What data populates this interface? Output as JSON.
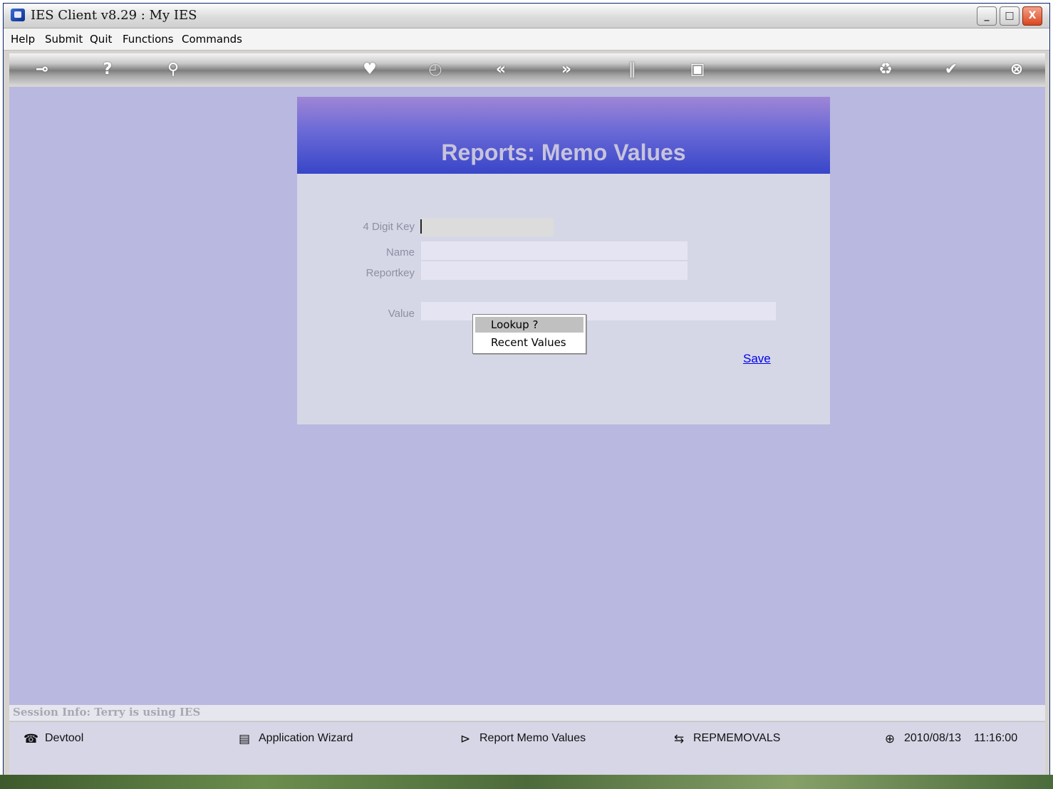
{
  "window": {
    "title": "IES Client v8.29 : My IES",
    "controls": {
      "minimize": "_",
      "maximize": "□",
      "close": "X"
    }
  },
  "menu": [
    "Help",
    "Submit",
    "Quit",
    "Functions",
    "Commands"
  ],
  "toolbar": {
    "icons": [
      "key-icon",
      "help-icon",
      "search-icon",
      "heart-icon",
      "clock-icon",
      "back-icon",
      "forward-icon",
      "tools-icon",
      "chip-icon",
      "recycle-icon",
      "check-icon",
      "close-icon"
    ],
    "glyphs": {
      "key": "⊸",
      "help": "?",
      "search": "⚲",
      "heart": "♥",
      "clock": "◴",
      "back": "«",
      "forward": "»",
      "tools": "‖",
      "chip": "▣",
      "recycle": "♻",
      "check": "✔",
      "close": "⊗"
    }
  },
  "form": {
    "title": "Reports: Memo Values",
    "fields": {
      "key_label": "4 Digit Key",
      "name_label": "Name",
      "reportkey_label": "Reportkey",
      "value_label": "Value"
    },
    "save_label": "Save"
  },
  "context_menu": {
    "items": [
      "Lookup ?",
      "Recent Values"
    ],
    "selected_index": 0
  },
  "session": {
    "text": "Session Info: Terry is using IES"
  },
  "statusbar": {
    "items": [
      {
        "icon": "phone-icon",
        "glyph": "☎",
        "label": "Devtool"
      },
      {
        "icon": "floppy-icon",
        "glyph": "▤",
        "label": "Application Wizard"
      },
      {
        "icon": "report-icon",
        "glyph": "⊳",
        "label": "Report Memo Values"
      },
      {
        "icon": "module-icon",
        "glyph": "⇆",
        "label": "REPMEMOVALS"
      }
    ],
    "date": "2010/08/13",
    "time": "11:16:00",
    "clock_glyph": "⊕"
  },
  "colors": {
    "desktop": "#b8b8e0",
    "panel": "#d5d7e6",
    "header_top": "#9f86d6",
    "header_bottom": "#3846c8",
    "link": "#0000ee"
  }
}
